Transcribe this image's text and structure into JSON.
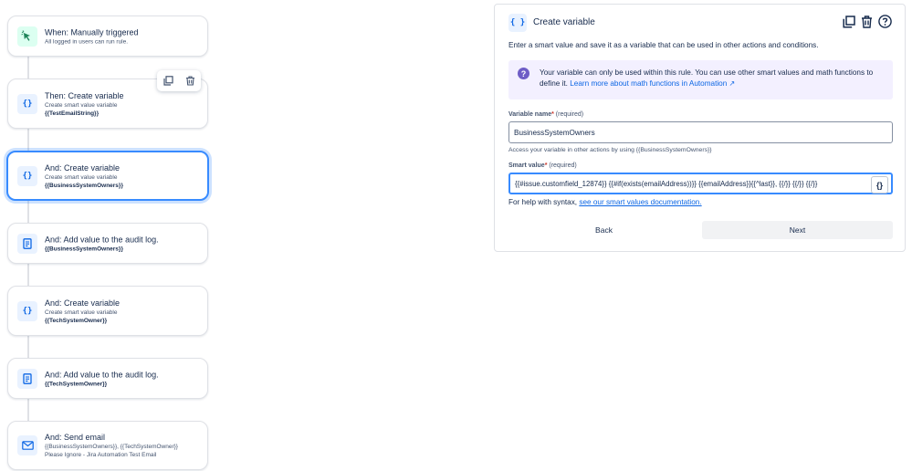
{
  "flow": {
    "steps": [
      {
        "title": "When: Manually triggered",
        "subtitle": "All logged in users can run rule.",
        "var": "",
        "icon": "cursor-click-icon"
      },
      {
        "title": "Then: Create variable",
        "subtitle": "Create smart value variable",
        "var": "{{TestEmailString}}",
        "icon": "curly-braces-icon"
      },
      {
        "title": "And: Create variable",
        "subtitle": "Create smart value variable",
        "var": "{{BusinessSystemOwners}}",
        "icon": "curly-braces-icon"
      },
      {
        "title": "And: Add value to the audit log.",
        "subtitle": "",
        "var": "{{BusinessSystemOwners}}",
        "icon": "log-document-icon"
      },
      {
        "title": "And: Create variable",
        "subtitle": "Create smart value variable",
        "var": "{{TechSystemOwner}}",
        "icon": "curly-braces-icon"
      },
      {
        "title": "And: Add value to the audit log.",
        "subtitle": "",
        "var": "{{TechSystemOwner}}",
        "icon": "log-document-icon"
      },
      {
        "title": "And: Send email",
        "subtitle": "{{BusinessSystemOwners}}, {{TechSystemOwner}}",
        "var": "Please Ignore - Jira Automation Test Email",
        "icon": "envelope-icon"
      }
    ]
  },
  "panel": {
    "icon_glyph": "{ }",
    "title": "Create variable",
    "description": "Enter a smart value and save it as a variable that can be used in other actions and conditions.",
    "info_text": "Your variable can only be used within this rule. You can use other smart values and math functions to define it.",
    "info_link": "Learn more about math functions in Automation ↗",
    "var_name_label": "Variable name",
    "required_mark": "*",
    "required_text": "(required)",
    "var_name_value": "BusinessSystemOwners",
    "var_name_hint": "Access your variable in other actions by using {{BusinessSystemOwners}}",
    "smart_value_label": "Smart value",
    "smart_value": "{{#issue.customfield_12874}}   {{#if(exists(emailAddress))}}      {{emailAddress}}{{^last}}, {{/}}    {{/}} {{/}}",
    "smart_value_button": "{}",
    "help_text": "For help with syntax,",
    "help_link": "see our smart values documentation.",
    "back_label": "Back",
    "next_label": "Next"
  },
  "colors": {
    "accent": "#388bff",
    "link": "#0c66e4",
    "info_bg": "#f3f0ff",
    "info_icon": "#6e5dc6",
    "trigger_bg": "#dcfff1"
  }
}
